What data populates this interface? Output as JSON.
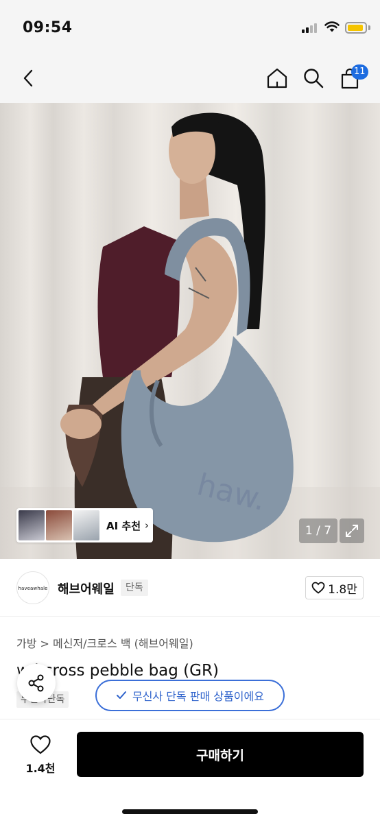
{
  "status_bar": {
    "time": "09:54",
    "battery_color": "#f5c400"
  },
  "nav": {
    "back_icon": "chevron-left-icon",
    "home_icon": "home-icon",
    "search_icon": "search-icon",
    "cart_icon": "shopping-bag-icon",
    "cart_count": "11",
    "badge_color": "#1d6ce0"
  },
  "product_image": {
    "counter": "1 / 7",
    "ai_recommend_label": "AI 추천",
    "ai_recommend_chevron": "›",
    "fullscreen_icon": "expand-icon"
  },
  "brand": {
    "logo_text": "haveawhale",
    "name": "해브어웨일",
    "exclusive_tag": "단독",
    "like_count": "1.8만"
  },
  "breadcrumb": "가방 > 메신저/크로스 백 (해브어웨일)",
  "product": {
    "title": "w  l cross pebble bag (GR)",
    "exclusive_label": "무신사단독"
  },
  "share_icon": "share-icon",
  "exclusive_banner": {
    "text": "무신사 단독 판매 상품이에요",
    "color": "#2f63cc"
  },
  "bottom_bar": {
    "wish_count": "1.4천",
    "buy_label": "구매하기"
  }
}
